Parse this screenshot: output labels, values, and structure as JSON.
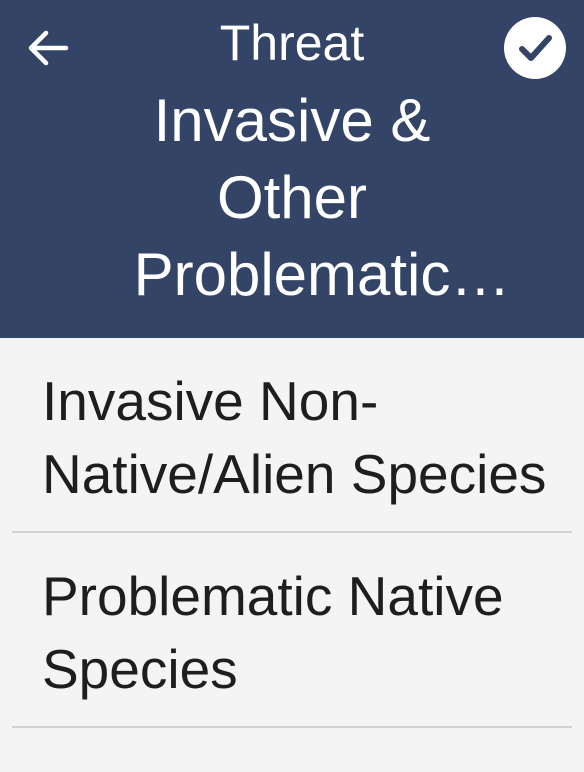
{
  "header": {
    "subtitle": "Threat",
    "title": "Invasive & Other Problematic Species",
    "background_color": "#334466",
    "back_icon": "arrow-left-icon",
    "confirm_icon": "check-circle-icon"
  },
  "options": [
    {
      "label": "Invasive Non-Native/Alien Species"
    },
    {
      "label": "Problematic Native Species"
    }
  ]
}
